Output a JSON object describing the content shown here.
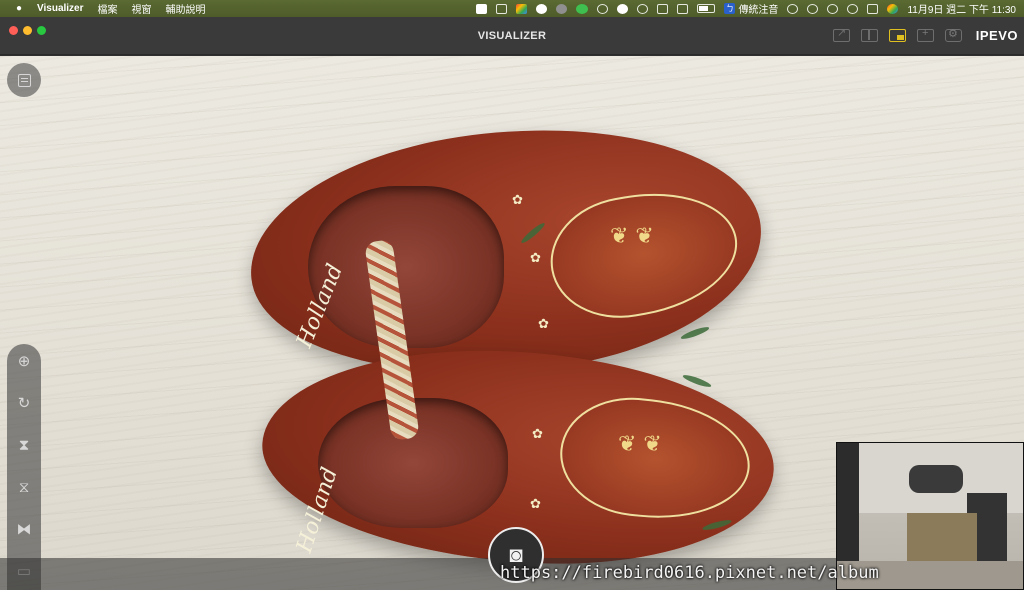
{
  "menubar": {
    "apple_icon": "apple-icon",
    "app_name": "Visualizer",
    "menus": [
      "檔案",
      "視窗",
      "輔助說明"
    ],
    "input_method": "傳統注音",
    "clock": "11月9日 週二 下午 11:30"
  },
  "window": {
    "title": "VISUALIZER",
    "brand": "IPEVO",
    "toolbar_icons": [
      "export-icon",
      "split-view-icon",
      "picture-in-picture-icon",
      "add-window-icon",
      "settings-icon"
    ],
    "active_toolbar_icon": "picture-in-picture-icon"
  },
  "camera": {
    "left_shoe_text": "Holland",
    "right_shoe_text": "Holland",
    "side_tools": [
      "zoom-icon",
      "rotate-icon",
      "flip-vertical-icon",
      "mirror-vertical-icon",
      "mirror-horizontal-icon",
      "more-icon"
    ]
  },
  "capture": {
    "icon": "camera-icon"
  },
  "watermark": "https://firebird0616.pixnet.net/album",
  "colors": {
    "menubar": "#566630",
    "titlebar": "#3a3a3a",
    "accent": "#e0c020",
    "shoe": "#8a2f1c"
  }
}
